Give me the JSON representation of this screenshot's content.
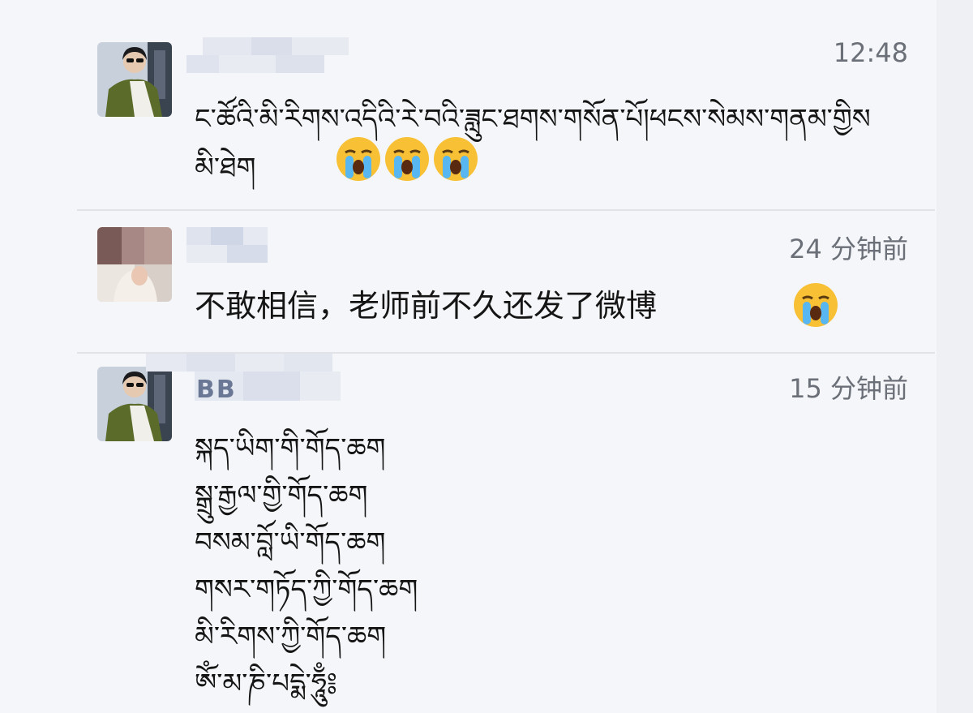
{
  "comments": [
    {
      "username": "",
      "time": "12:48",
      "lines": [
        "ང་ཚོའི་མི་རིགས་འདིའི་རེ་བའི་ཟླུང་ཐགས་གསོན་པོ།ཕངས་སེམས་གནམ་གྱིས",
        "མི་ཐེག"
      ],
      "emoji": [
        "crying-face",
        "crying-face",
        "crying-face"
      ]
    },
    {
      "username": "",
      "time": "24 分钟前",
      "lines": [
        "不敢相信，老师前不久还发了微博"
      ],
      "emoji": [
        "crying-face"
      ]
    },
    {
      "username": "BB",
      "time": "15 分钟前",
      "lines": [
        "སྐད་ཡིག་གི་གོད་ཆག",
        "སྒྲུ་རྒྱལ་གྱི་གོད་ཆག",
        "བསམ་བློ་ཡི་གོད་ཆག",
        "གསར་གཏོད་ཀྱི་གོད་ཆག",
        "མི་རིགས་ཀྱི་གོད་ཆག",
        "ཨོཾ་མ་ཎི་པདྨེ་ཧཱུྃ༔"
      ],
      "emoji": []
    }
  ],
  "colors": {
    "background": "#f5f6f9",
    "divider": "#e2e3e8",
    "timestamp": "#6b6f78",
    "text": "#151515"
  }
}
